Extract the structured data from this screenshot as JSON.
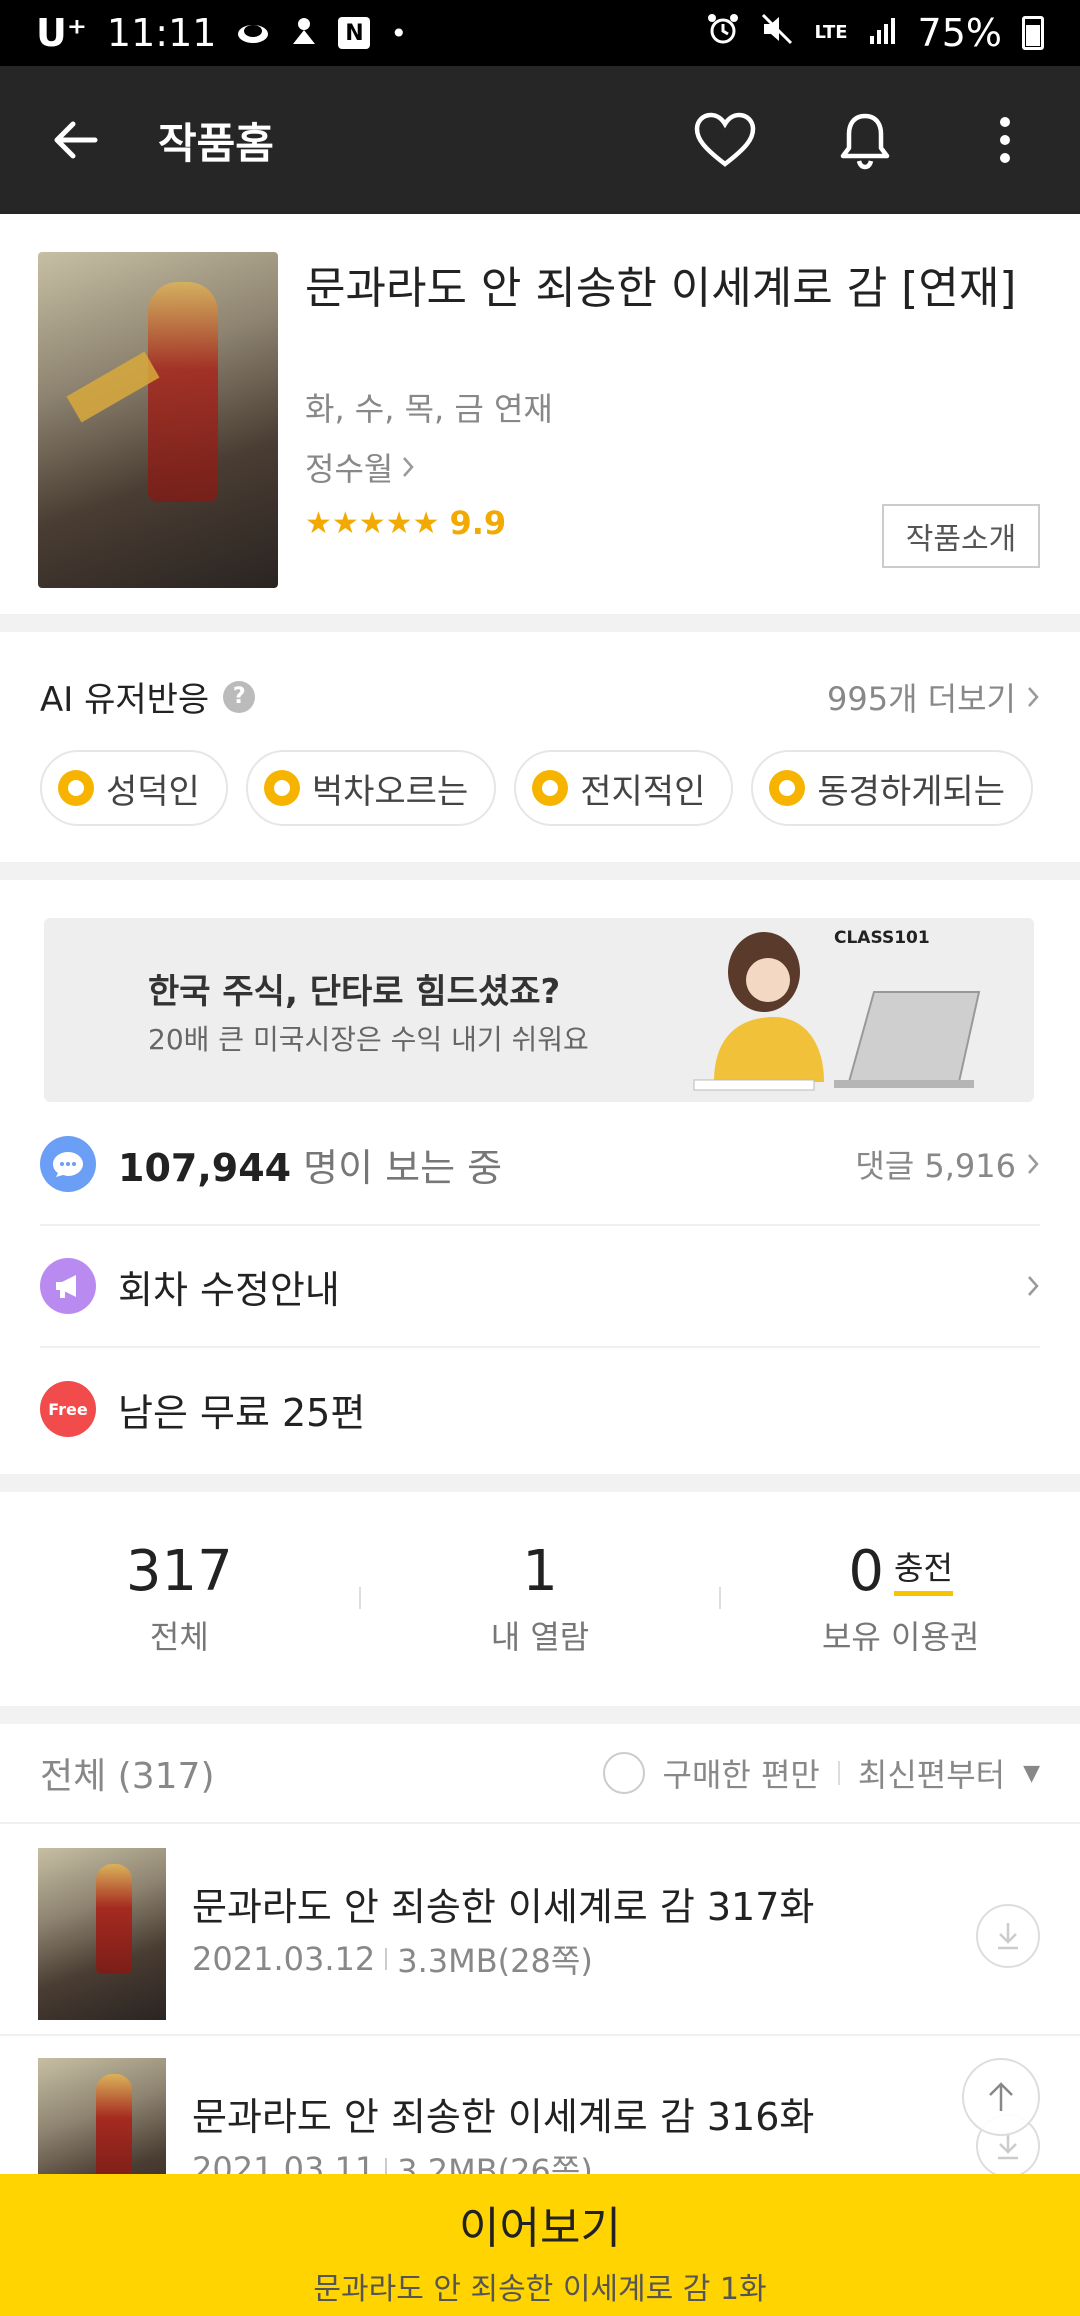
{
  "status_bar": {
    "carrier": "U⁺",
    "time": "11:11",
    "notification_badge": "N",
    "dot": "•",
    "network": "LTE",
    "battery": "75%"
  },
  "app_bar": {
    "title": "작품홈"
  },
  "series": {
    "title": "문과라도 안 죄송한 이세계로 감 [연재]",
    "schedule": "화, 수, 목, 금 연재",
    "author": "정수월",
    "stars": "★★★★★",
    "rating": "9.9",
    "intro_button": "작품소개"
  },
  "ai_reactions": {
    "title": "AI 유저반응",
    "help": "?",
    "more": "995개 더보기",
    "chips": [
      "성덕인",
      "벅차오르는",
      "전지적인",
      "동경하게되는"
    ]
  },
  "ad": {
    "headline": "한국 주식, 단타로 힘드셨죠?",
    "subline": "20배 큰 미국시장은 수익 내기 쉬워요",
    "brand": "CLASS101"
  },
  "info_rows": {
    "viewers_count": "107,944",
    "viewers_suffix": "명이 보는 중",
    "comments": "댓글 5,916",
    "notice": "회차 수정안내",
    "free_badge": "Free",
    "free_remaining": "남은 무료 25편"
  },
  "stats": {
    "total_num": "317",
    "total_label": "전체",
    "read_num": "1",
    "read_label": "내 열람",
    "ticket_num": "0",
    "ticket_charge": "충전",
    "ticket_label": "보유 이용권"
  },
  "list": {
    "count_label": "전체 (317)",
    "purchased_only": "구매한 편만",
    "sort": "최신편부터"
  },
  "episodes": [
    {
      "title": "문과라도 안 죄송한 이세계로 감 317화",
      "date": "2021.03.12",
      "size": "3.3MB(28쪽)"
    },
    {
      "title": "문과라도 안 죄송한 이세계로 감 316화",
      "date": "2021.03.11",
      "size": "3.2MB(26쪽)"
    }
  ],
  "cta": {
    "main": "이어보기",
    "sub": "문과라도 안 죄송한 이세계로 감 1화"
  },
  "colors": {
    "app_bar": "#262626",
    "accent_yellow": "#ffd400",
    "rating_gold": "#f2a900",
    "chat_blue": "#6b9ef5",
    "notice_purple": "#b98bf0",
    "free_red": "#f24b4b"
  }
}
